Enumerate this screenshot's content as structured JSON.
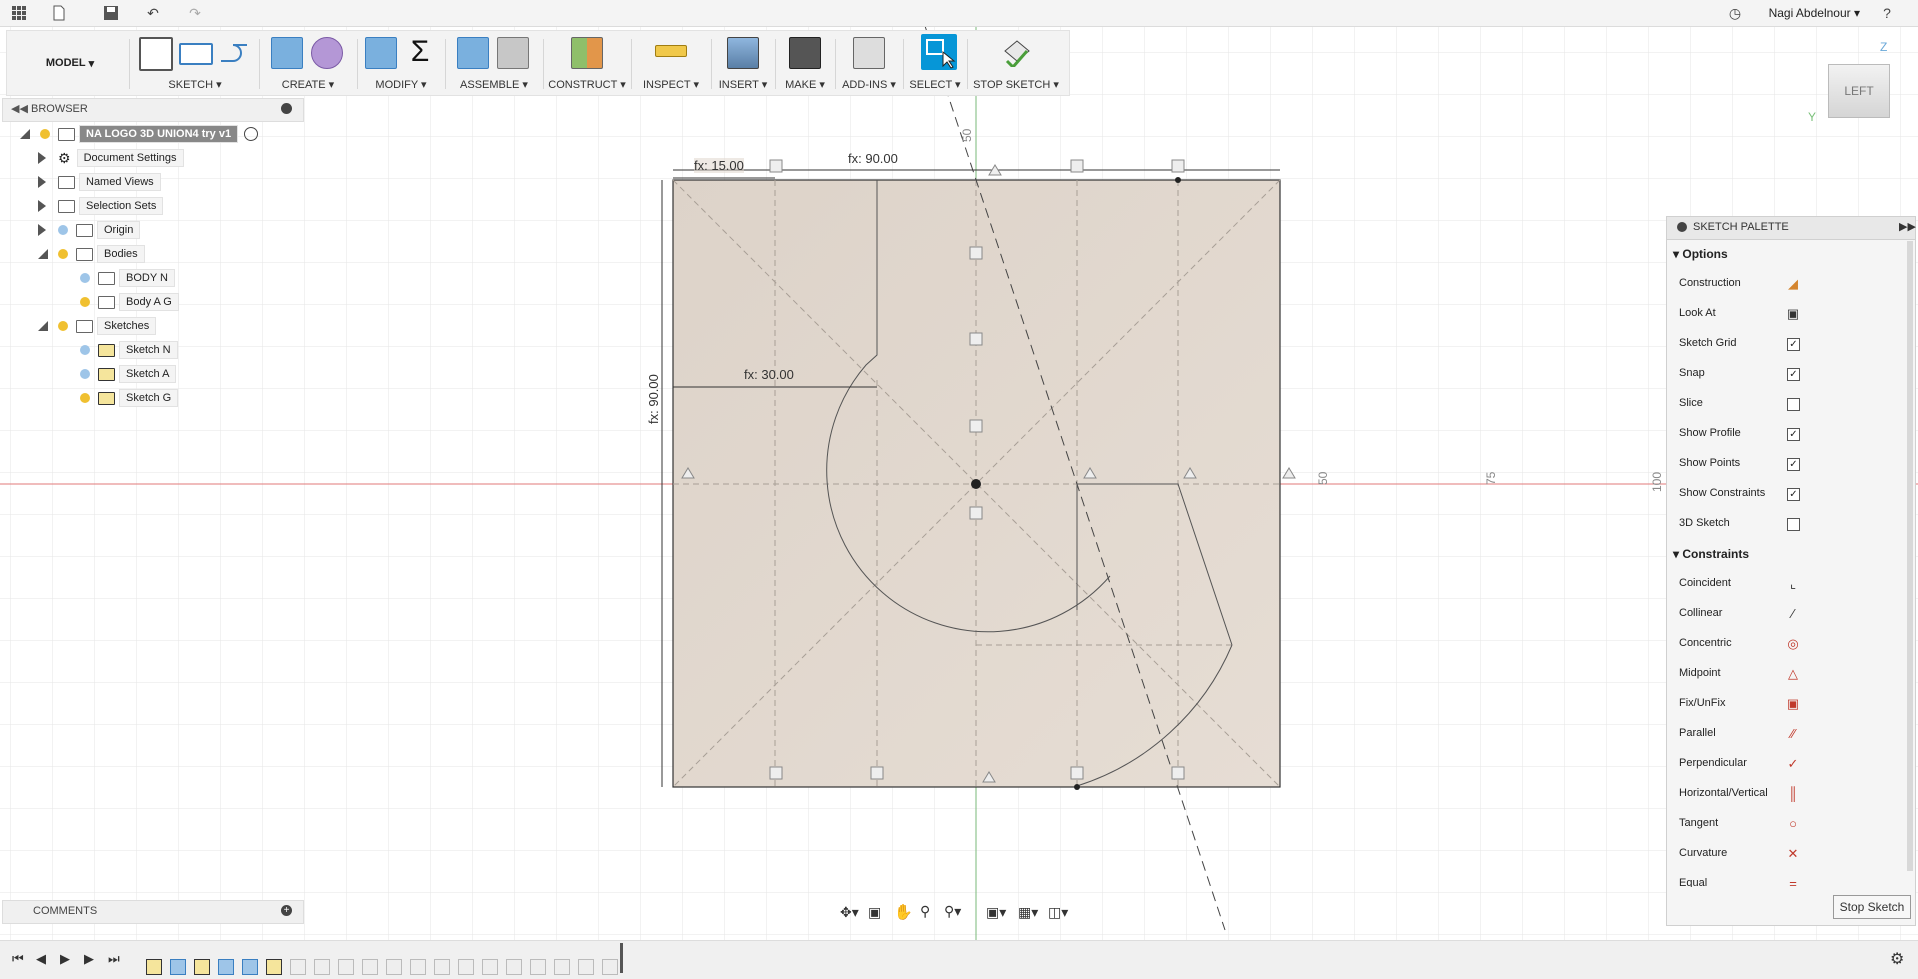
{
  "top": {
    "user": "Nagi Abdelnour"
  },
  "toolbar": {
    "model": "MODEL",
    "groups": [
      "SKETCH",
      "CREATE",
      "MODIFY",
      "ASSEMBLE",
      "CONSTRUCT",
      "INSPECT",
      "INSERT",
      "MAKE",
      "ADD-INS",
      "SELECT",
      "STOP SKETCH"
    ]
  },
  "browser": {
    "title": "BROWSER",
    "root": "NA LOGO 3D UNION4 try v1",
    "items": [
      "Document Settings",
      "Named Views",
      "Selection Sets",
      "Origin",
      "Bodies",
      "BODY N",
      "Body A G",
      "Sketches",
      "Sketch N",
      "Sketch A",
      "Sketch G"
    ]
  },
  "comments": {
    "title": "COMMENTS"
  },
  "viewcube": {
    "face": "LEFT",
    "axis_z": "Z",
    "axis_y": "Y"
  },
  "sketch": {
    "dims": [
      "fx: 15.00",
      "fx: 90.00",
      "fx: 30.00",
      "fx: 90.00"
    ],
    "axis_labels": [
      "50",
      "75",
      "100",
      "50"
    ]
  },
  "palette": {
    "title": "SKETCH PALETTE",
    "options_title": "Options",
    "options": [
      {
        "label": "Construction",
        "icon": "construction-icon"
      },
      {
        "label": "Look At",
        "icon": "look-at-icon"
      },
      {
        "label": "Sketch Grid",
        "checked": true
      },
      {
        "label": "Snap",
        "checked": true
      },
      {
        "label": "Slice",
        "checked": false
      },
      {
        "label": "Show Profile",
        "checked": true
      },
      {
        "label": "Show Points",
        "checked": true
      },
      {
        "label": "Show Constraints",
        "checked": true
      },
      {
        "label": "3D Sketch",
        "checked": false
      }
    ],
    "constraints_title": "Constraints",
    "constraints": [
      {
        "label": "Coincident",
        "icon": "coincident-icon"
      },
      {
        "label": "Collinear",
        "icon": "collinear-icon"
      },
      {
        "label": "Concentric",
        "icon": "concentric-icon"
      },
      {
        "label": "Midpoint",
        "icon": "midpoint-icon"
      },
      {
        "label": "Fix/UnFix",
        "icon": "fix-icon"
      },
      {
        "label": "Parallel",
        "icon": "parallel-icon"
      },
      {
        "label": "Perpendicular",
        "icon": "perpendicular-icon"
      },
      {
        "label": "Horizontal/Vertical",
        "icon": "horizontal-vertical-icon"
      },
      {
        "label": "Tangent",
        "icon": "tangent-icon"
      },
      {
        "label": "Curvature",
        "icon": "curvature-icon"
      },
      {
        "label": "Equal",
        "icon": "equal-icon"
      }
    ],
    "stop": "Stop Sketch"
  },
  "colors": {
    "accent": "#0696d7",
    "sketch_fill": "#e0d6cc",
    "xaxis": "#d9534f",
    "yaxis": "#5cb85c"
  }
}
